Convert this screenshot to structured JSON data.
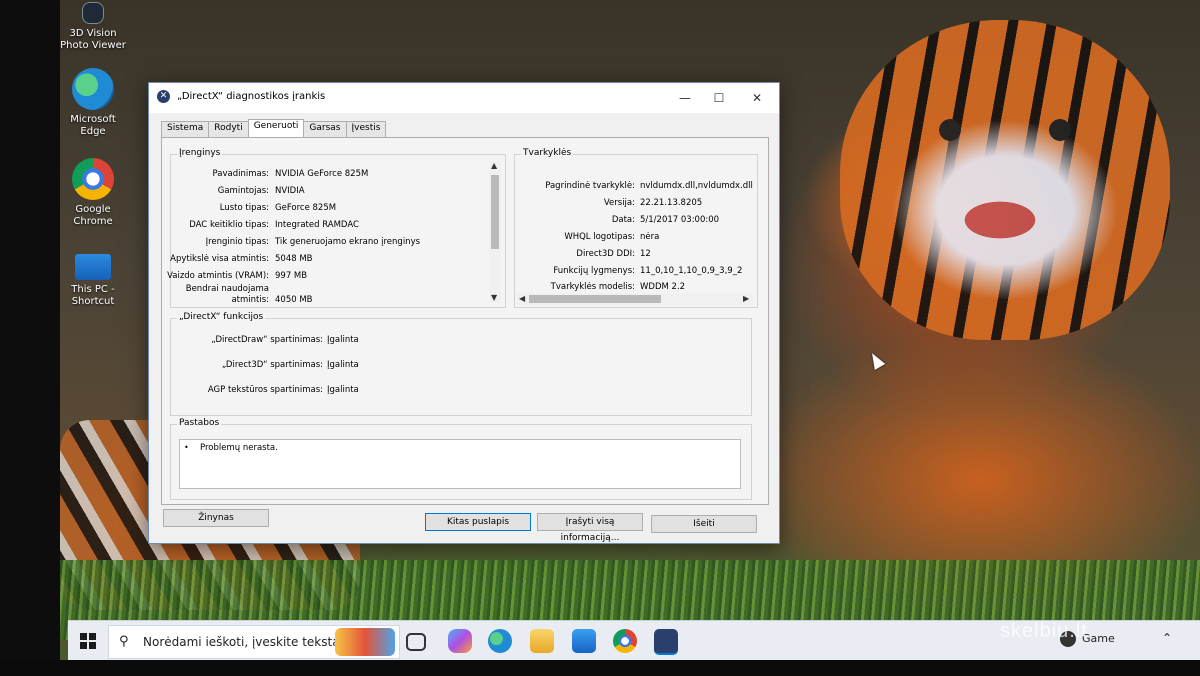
{
  "desktop": {
    "icons": [
      {
        "label": "3D Vision Photo Viewer",
        "icon": "3d-vision-icon"
      },
      {
        "label": "Microsoft Edge",
        "icon": "edge-icon"
      },
      {
        "label": "Google Chrome",
        "icon": "chrome-icon"
      },
      {
        "label": "This PC - Shortcut",
        "icon": "this-pc-icon"
      }
    ]
  },
  "window": {
    "title": "„DirectX“ diagnostikos įrankis",
    "controls": {
      "minimize": "—",
      "maximize": "☐",
      "close": "✕"
    },
    "tabs": [
      "Sistema",
      "Rodyti",
      "Generuoti",
      "Garsas",
      "Įvestis"
    ],
    "active_tab": "Generuoti",
    "device": {
      "title": "Įrenginys",
      "rows": [
        {
          "key": "Pavadinimas:",
          "value": "NVIDIA GeForce 825M"
        },
        {
          "key": "Gamintojas:",
          "value": "NVIDIA"
        },
        {
          "key": "Lusto tipas:",
          "value": "GeForce 825M"
        },
        {
          "key": "DAC keitiklio tipas:",
          "value": "Integrated RAMDAC"
        },
        {
          "key": "Įrenginio tipas:",
          "value": "Tik generuojamo ekrano įrenginys"
        },
        {
          "key": "Apytikslė visa atmintis:",
          "value": "5048 MB"
        },
        {
          "key": "Vaizdo atmintis (VRAM):",
          "value": "997 MB"
        },
        {
          "key": "Bendrai naudojama",
          "value": ""
        },
        {
          "key": "atmintis:",
          "value": "4050 MB"
        }
      ]
    },
    "drivers": {
      "title": "Tvarkyklės",
      "rows": [
        {
          "key": "Pagrindinė tvarkyklė:",
          "value": "nvldumdx.dll,nvldumdx.dll"
        },
        {
          "key": "Versija:",
          "value": "22.21.13.8205"
        },
        {
          "key": "Data:",
          "value": "5/1/2017 03:00:00"
        },
        {
          "key": "WHQL logotipas:",
          "value": "nėra"
        },
        {
          "key": "Direct3D DDI:",
          "value": "12"
        },
        {
          "key": "Funkcijų lygmenys:",
          "value": "11_0,10_1,10_0,9_3,9_2"
        },
        {
          "key": "Tvarkyklės modelis:",
          "value": "WDDM 2.2"
        }
      ]
    },
    "features": {
      "title": "„DirectX“ funkcijos",
      "rows": [
        {
          "key": "„DirectDraw“ spartinimas:",
          "value": "Įgalinta"
        },
        {
          "key": "„Direct3D“ spartinimas:",
          "value": "Įgalinta"
        },
        {
          "key": "AGP tekstūros spartinimas:",
          "value": "Įgalinta"
        }
      ]
    },
    "notes": {
      "title": "Pastabos",
      "bullet": "•",
      "text": "Problemų nerasta."
    },
    "buttons": {
      "help": "Žinynas",
      "next": "Kitas puslapis",
      "save_all": "Įrašyti visą informaciją...",
      "exit": "Išeiti"
    }
  },
  "taskbar": {
    "search_placeholder": "Norėdami ieškoti, įveskite tekstą",
    "tray_label": "Game",
    "apps": [
      "task-view-icon",
      "copilot-icon",
      "edge-icon",
      "file-explorer-icon",
      "mail-icon",
      "chrome-icon",
      "directx-icon"
    ]
  },
  "watermark": "skelbiu.lt",
  "colors": {
    "window_border": "#6d8bb3",
    "default_button": "#0078d7",
    "taskbar": "#e9edf3"
  }
}
